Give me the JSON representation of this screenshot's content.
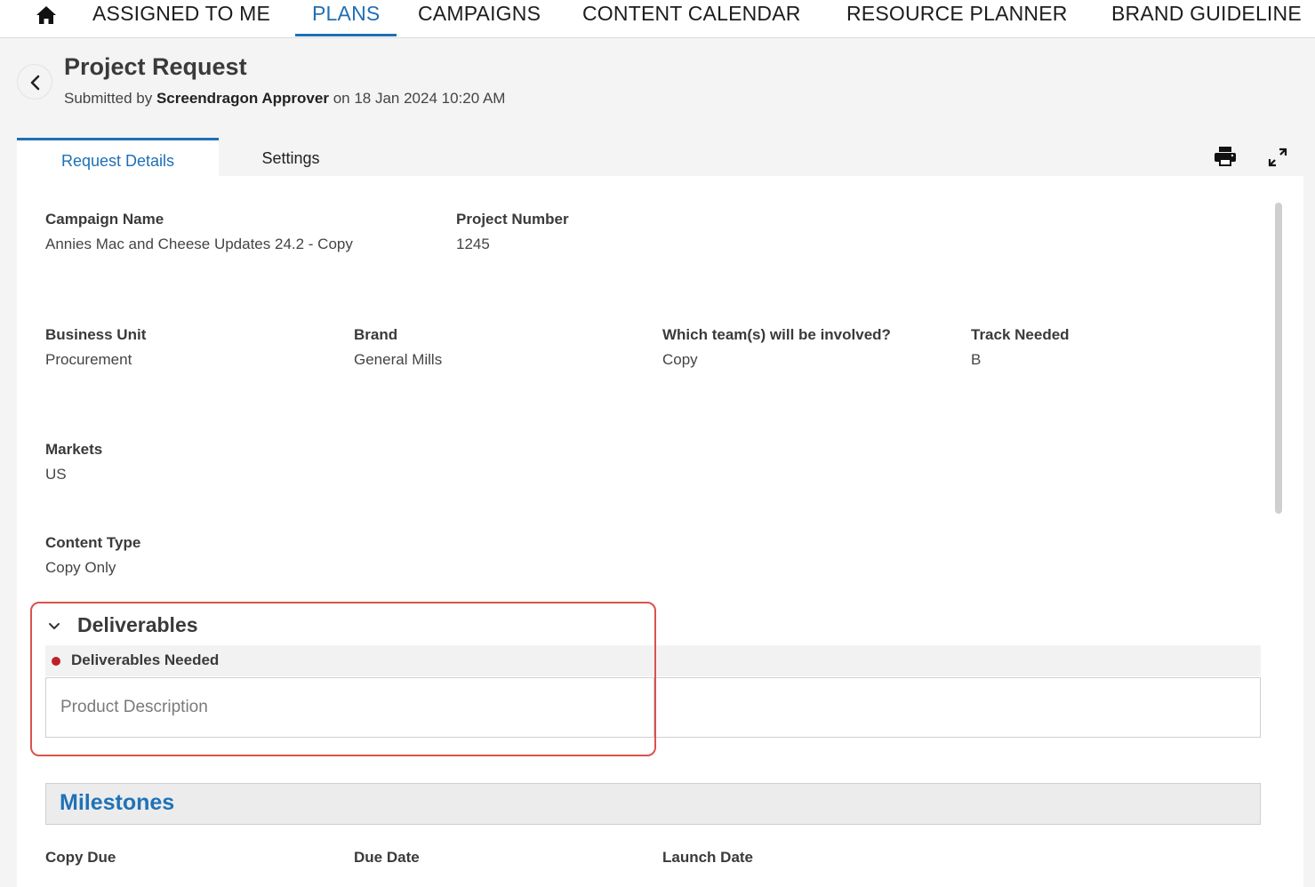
{
  "nav": {
    "items": [
      "ASSIGNED TO ME",
      "PLANS",
      "CAMPAIGNS",
      "CONTENT CALENDAR",
      "RESOURCE PLANNER",
      "BRAND GUIDELINE"
    ],
    "active": "PLANS",
    "home_icon": "home-icon"
  },
  "header": {
    "title": "Project Request",
    "submitted_prefix": "Submitted by",
    "submitted_by": "Screendragon Approver",
    "submitted_on": "on 18 Jan 2024 10:20 AM"
  },
  "tabs": [
    {
      "label": "Request Details",
      "active": true
    },
    {
      "label": "Settings",
      "active": false
    }
  ],
  "toolbar_icons": [
    "print-icon",
    "expand-icon"
  ],
  "fields": {
    "campaign_name": {
      "label": "Campaign Name",
      "value": "Annies Mac and Cheese Updates 24.2 - Copy"
    },
    "project_number": {
      "label": "Project Number",
      "value": "1245"
    },
    "business_unit": {
      "label": "Business Unit",
      "value": "Procurement"
    },
    "brand": {
      "label": "Brand",
      "value": "General Mills"
    },
    "teams": {
      "label": "Which team(s) will be involved?",
      "value": "Copy"
    },
    "track": {
      "label": "Track Needed",
      "value": "B"
    },
    "markets": {
      "label": "Markets",
      "value": "US"
    },
    "content_type": {
      "label": "Content Type",
      "value": "Copy Only"
    }
  },
  "deliverables": {
    "title": "Deliverables",
    "needed_label": "Deliverables Needed",
    "placeholder": "Product Description"
  },
  "milestones": {
    "title": "Milestones",
    "columns": [
      "Copy Due",
      "Due Date",
      "Launch Date"
    ]
  },
  "colors": {
    "accent": "#1f6fb5",
    "highlight": "#d9534a",
    "required": "#c0202a"
  }
}
